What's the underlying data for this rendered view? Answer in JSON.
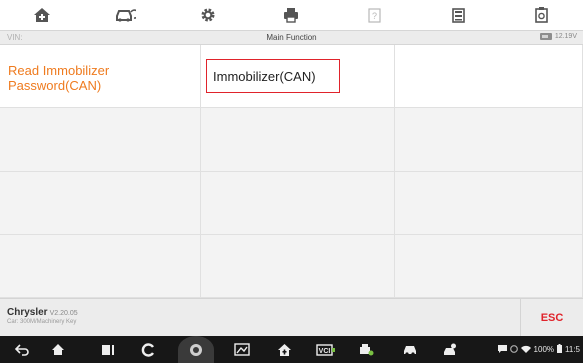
{
  "toolbar": {
    "buttons": [
      {
        "name": "home-button",
        "icon": "home-icon"
      },
      {
        "name": "vehicle-button",
        "icon": "vehicle-swap-icon"
      },
      {
        "name": "settings-button",
        "icon": "gear-icon"
      },
      {
        "name": "print-button",
        "icon": "printer-icon"
      },
      {
        "name": "help-button",
        "icon": "help-icon"
      },
      {
        "name": "save-button",
        "icon": "save-icon"
      },
      {
        "name": "datalog-button",
        "icon": "datalog-icon"
      }
    ]
  },
  "status": {
    "vin_label": "VIN:",
    "title": "Main Function",
    "battery_voltage": "12.19V"
  },
  "functions": {
    "items": [
      {
        "label": "Read Immobilizer Password(CAN)"
      },
      {
        "label": "Immobilizer(CAN)"
      }
    ]
  },
  "footer": {
    "make": "Chrysler",
    "version": "V2.20.05",
    "car_info": "Car: 300M/Machinery Key",
    "esc_label": "ESC"
  },
  "android_nav": {
    "icons": [
      "back-icon",
      "home-icon",
      "recents-icon",
      "browser-icon",
      "camera-icon",
      "screenshot-icon",
      "vehicle-home-icon",
      "vci-icon",
      "fuel-icon",
      "car-icon",
      "service-icon"
    ]
  },
  "system_tray": {
    "battery_percent": "100%",
    "time": "11:5"
  },
  "colors": {
    "accent_orange": "#ef7b1f",
    "highlight_red": "#e0232b",
    "nav_bar": "#171717"
  }
}
